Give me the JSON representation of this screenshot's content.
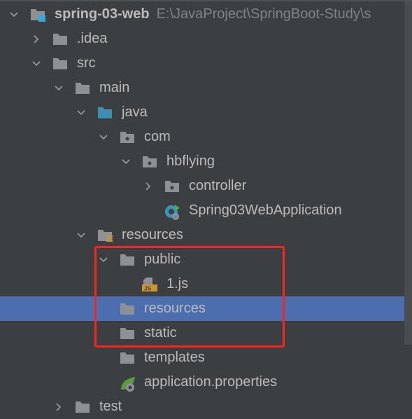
{
  "project": {
    "name": "spring-03-web",
    "path": "E:\\JavaProject\\SpringBoot-Study\\s"
  },
  "colors": {
    "background": "#3c3f41",
    "selection": "#4b6eaf",
    "highlight_box": "#ff2020",
    "folder": "#8c9196",
    "source_folder": "#3d8fb3",
    "js_badge": "#c9962f"
  },
  "tree": [
    {
      "label": "spring-03-web",
      "level": 0,
      "arrow": "down",
      "icon": "module-folder-icon"
    },
    {
      "label": ".idea",
      "level": 1,
      "arrow": "right",
      "icon": "folder-icon"
    },
    {
      "label": "src",
      "level": 1,
      "arrow": "down",
      "icon": "folder-icon"
    },
    {
      "label": "main",
      "level": 2,
      "arrow": "down",
      "icon": "folder-icon"
    },
    {
      "label": "java",
      "level": 3,
      "arrow": "down",
      "icon": "source-folder-icon"
    },
    {
      "label": "com",
      "level": 4,
      "arrow": "down",
      "icon": "package-icon"
    },
    {
      "label": "hbflying",
      "level": 5,
      "arrow": "down",
      "icon": "package-icon"
    },
    {
      "label": "controller",
      "level": 6,
      "arrow": "right",
      "icon": "package-icon"
    },
    {
      "label": "Spring03WebApplication",
      "level": 6,
      "arrow": "none",
      "icon": "spring-boot-class-icon"
    },
    {
      "label": "resources",
      "level": 3,
      "arrow": "down",
      "icon": "resources-folder-icon"
    },
    {
      "label": "public",
      "level": 4,
      "arrow": "down",
      "icon": "folder-icon"
    },
    {
      "label": "1.js",
      "level": 5,
      "arrow": "none",
      "icon": "js-file-icon"
    },
    {
      "label": "resources",
      "level": 4,
      "arrow": "none",
      "icon": "folder-icon",
      "selected": true
    },
    {
      "label": "static",
      "level": 4,
      "arrow": "none",
      "icon": "folder-icon"
    },
    {
      "label": "templates",
      "level": 4,
      "arrow": "none",
      "icon": "folder-icon"
    },
    {
      "label": "application.properties",
      "level": 4,
      "arrow": "none",
      "icon": "spring-properties-icon"
    },
    {
      "label": "test",
      "level": 2,
      "arrow": "right",
      "icon": "folder-icon"
    }
  ]
}
